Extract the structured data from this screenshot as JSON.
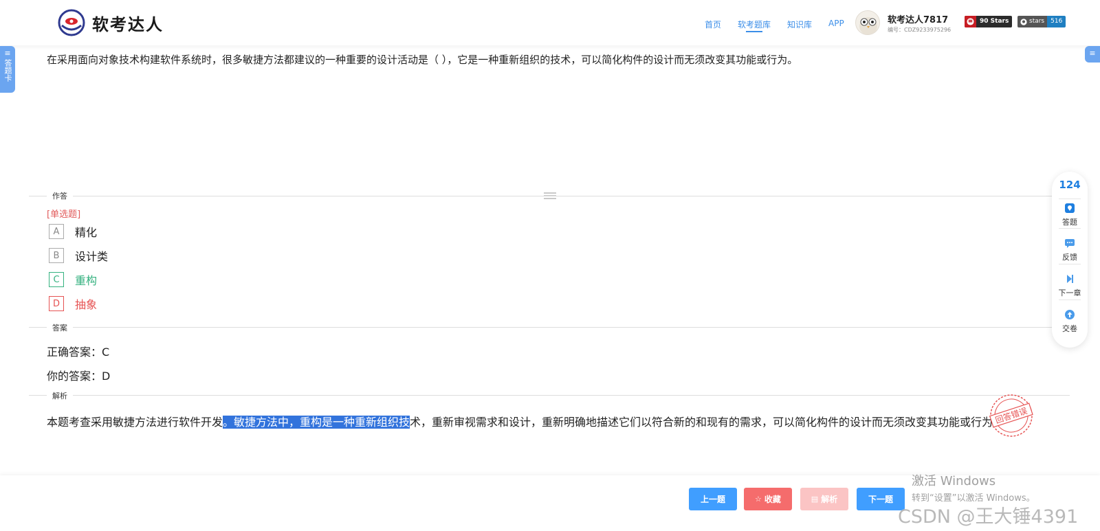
{
  "header": {
    "logo_text": "软考达人",
    "nav": [
      {
        "label": "首页",
        "active": false
      },
      {
        "label": "软考题库",
        "active": true
      },
      {
        "label": "知识库",
        "active": false
      },
      {
        "label": "APP",
        "active": false
      }
    ],
    "user": {
      "name": "软考达人7817",
      "id_text": "编号：CDZ9233975296"
    },
    "gitee_badge": {
      "icon": "gitee-icon",
      "text": "90 Stars"
    },
    "github_badge": {
      "label": "stars",
      "count": "516"
    }
  },
  "sidebar_left": {
    "answer_card_label": "答题卡"
  },
  "question": {
    "text": "在采用面向对象技术构建软件系统时，很多敏捷方法都建议的一种重要的设计活动是（ ），它是一种重新组织的技术，可以简化构件的设计而无须改变其功能或行为。"
  },
  "answer_section": {
    "label": "作答",
    "type_label": "[单选题]",
    "options": [
      {
        "letter": "A",
        "text": "精化",
        "state": "normal"
      },
      {
        "letter": "B",
        "text": "设计类",
        "state": "normal"
      },
      {
        "letter": "C",
        "text": "重构",
        "state": "correct"
      },
      {
        "letter": "D",
        "text": "抽象",
        "state": "wrong"
      }
    ]
  },
  "result_section": {
    "label": "答案",
    "correct_answer": "正确答案：C",
    "your_answer": "你的答案：D",
    "stamp_text": "回答错误"
  },
  "analysis_section": {
    "label": "解析",
    "text_before": "本题考查采用敏捷方法进行软件开发",
    "text_highlight": "。敏捷方法中，重构是一种重新组织技",
    "text_after": "术，重新审视需求和设计，重新明确地描述它们以符合新的和现有的需求，可以简化构件的设计而无须改变其功能或行为。"
  },
  "toolbar": {
    "count": "124",
    "items": [
      {
        "label": "答题",
        "icon": "answer-icon"
      },
      {
        "label": "反馈",
        "icon": "feedback-icon"
      },
      {
        "label": "下一章",
        "icon": "next-chapter-icon"
      },
      {
        "label": "交卷",
        "icon": "submit-icon"
      }
    ]
  },
  "footer": {
    "prev_label": "上一题",
    "fav_label": "收藏",
    "analysis_label": "解析",
    "next_label": "下一题"
  },
  "watermarks": {
    "windows_line1": "激活 Windows",
    "windows_line2": "转到“设置”以激活 Windows。",
    "csdn": "CSDN @王大锤4391"
  },
  "colors": {
    "primary": "#409eff",
    "correct": "#34b17f",
    "wrong": "#e65252",
    "highlight": "#3273dc"
  }
}
